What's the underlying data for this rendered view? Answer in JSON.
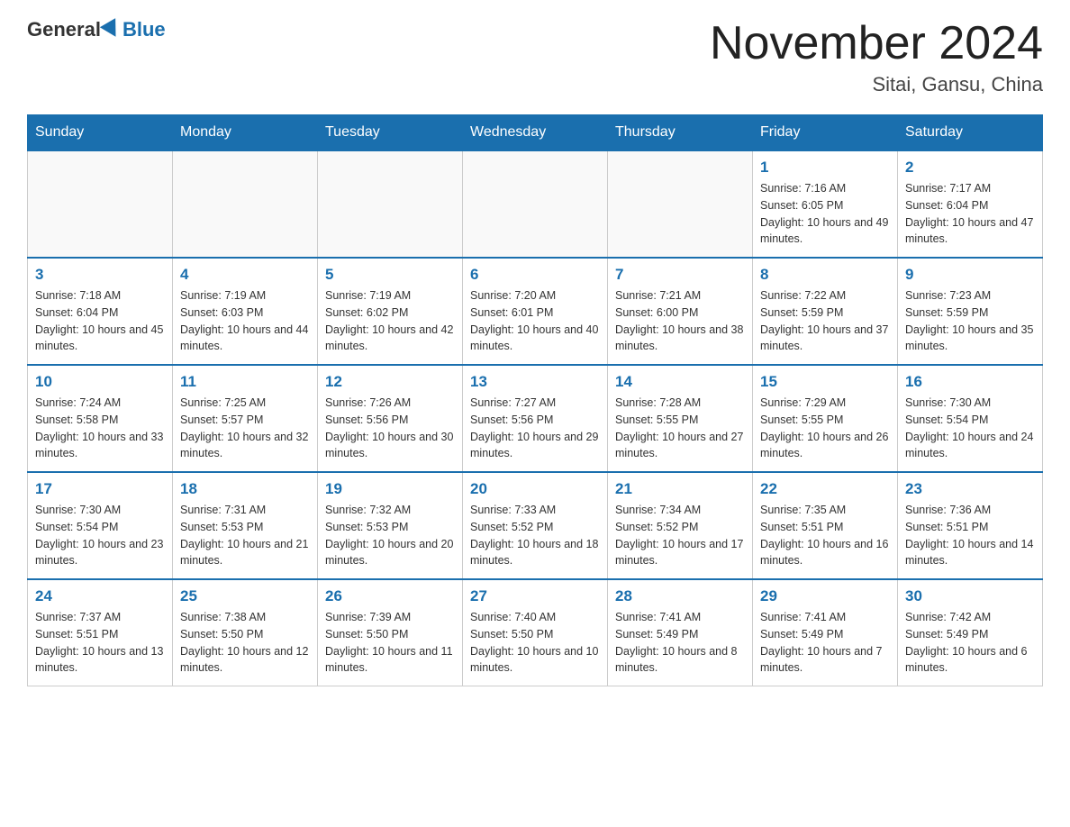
{
  "header": {
    "logo_general": "General",
    "logo_blue": "Blue",
    "month_title": "November 2024",
    "location": "Sitai, Gansu, China"
  },
  "days_of_week": [
    "Sunday",
    "Monday",
    "Tuesday",
    "Wednesday",
    "Thursday",
    "Friday",
    "Saturday"
  ],
  "weeks": [
    [
      {
        "day": "",
        "info": ""
      },
      {
        "day": "",
        "info": ""
      },
      {
        "day": "",
        "info": ""
      },
      {
        "day": "",
        "info": ""
      },
      {
        "day": "",
        "info": ""
      },
      {
        "day": "1",
        "info": "Sunrise: 7:16 AM\nSunset: 6:05 PM\nDaylight: 10 hours and 49 minutes."
      },
      {
        "day": "2",
        "info": "Sunrise: 7:17 AM\nSunset: 6:04 PM\nDaylight: 10 hours and 47 minutes."
      }
    ],
    [
      {
        "day": "3",
        "info": "Sunrise: 7:18 AM\nSunset: 6:04 PM\nDaylight: 10 hours and 45 minutes."
      },
      {
        "day": "4",
        "info": "Sunrise: 7:19 AM\nSunset: 6:03 PM\nDaylight: 10 hours and 44 minutes."
      },
      {
        "day": "5",
        "info": "Sunrise: 7:19 AM\nSunset: 6:02 PM\nDaylight: 10 hours and 42 minutes."
      },
      {
        "day": "6",
        "info": "Sunrise: 7:20 AM\nSunset: 6:01 PM\nDaylight: 10 hours and 40 minutes."
      },
      {
        "day": "7",
        "info": "Sunrise: 7:21 AM\nSunset: 6:00 PM\nDaylight: 10 hours and 38 minutes."
      },
      {
        "day": "8",
        "info": "Sunrise: 7:22 AM\nSunset: 5:59 PM\nDaylight: 10 hours and 37 minutes."
      },
      {
        "day": "9",
        "info": "Sunrise: 7:23 AM\nSunset: 5:59 PM\nDaylight: 10 hours and 35 minutes."
      }
    ],
    [
      {
        "day": "10",
        "info": "Sunrise: 7:24 AM\nSunset: 5:58 PM\nDaylight: 10 hours and 33 minutes."
      },
      {
        "day": "11",
        "info": "Sunrise: 7:25 AM\nSunset: 5:57 PM\nDaylight: 10 hours and 32 minutes."
      },
      {
        "day": "12",
        "info": "Sunrise: 7:26 AM\nSunset: 5:56 PM\nDaylight: 10 hours and 30 minutes."
      },
      {
        "day": "13",
        "info": "Sunrise: 7:27 AM\nSunset: 5:56 PM\nDaylight: 10 hours and 29 minutes."
      },
      {
        "day": "14",
        "info": "Sunrise: 7:28 AM\nSunset: 5:55 PM\nDaylight: 10 hours and 27 minutes."
      },
      {
        "day": "15",
        "info": "Sunrise: 7:29 AM\nSunset: 5:55 PM\nDaylight: 10 hours and 26 minutes."
      },
      {
        "day": "16",
        "info": "Sunrise: 7:30 AM\nSunset: 5:54 PM\nDaylight: 10 hours and 24 minutes."
      }
    ],
    [
      {
        "day": "17",
        "info": "Sunrise: 7:30 AM\nSunset: 5:54 PM\nDaylight: 10 hours and 23 minutes."
      },
      {
        "day": "18",
        "info": "Sunrise: 7:31 AM\nSunset: 5:53 PM\nDaylight: 10 hours and 21 minutes."
      },
      {
        "day": "19",
        "info": "Sunrise: 7:32 AM\nSunset: 5:53 PM\nDaylight: 10 hours and 20 minutes."
      },
      {
        "day": "20",
        "info": "Sunrise: 7:33 AM\nSunset: 5:52 PM\nDaylight: 10 hours and 18 minutes."
      },
      {
        "day": "21",
        "info": "Sunrise: 7:34 AM\nSunset: 5:52 PM\nDaylight: 10 hours and 17 minutes."
      },
      {
        "day": "22",
        "info": "Sunrise: 7:35 AM\nSunset: 5:51 PM\nDaylight: 10 hours and 16 minutes."
      },
      {
        "day": "23",
        "info": "Sunrise: 7:36 AM\nSunset: 5:51 PM\nDaylight: 10 hours and 14 minutes."
      }
    ],
    [
      {
        "day": "24",
        "info": "Sunrise: 7:37 AM\nSunset: 5:51 PM\nDaylight: 10 hours and 13 minutes."
      },
      {
        "day": "25",
        "info": "Sunrise: 7:38 AM\nSunset: 5:50 PM\nDaylight: 10 hours and 12 minutes."
      },
      {
        "day": "26",
        "info": "Sunrise: 7:39 AM\nSunset: 5:50 PM\nDaylight: 10 hours and 11 minutes."
      },
      {
        "day": "27",
        "info": "Sunrise: 7:40 AM\nSunset: 5:50 PM\nDaylight: 10 hours and 10 minutes."
      },
      {
        "day": "28",
        "info": "Sunrise: 7:41 AM\nSunset: 5:49 PM\nDaylight: 10 hours and 8 minutes."
      },
      {
        "day": "29",
        "info": "Sunrise: 7:41 AM\nSunset: 5:49 PM\nDaylight: 10 hours and 7 minutes."
      },
      {
        "day": "30",
        "info": "Sunrise: 7:42 AM\nSunset: 5:49 PM\nDaylight: 10 hours and 6 minutes."
      }
    ]
  ]
}
